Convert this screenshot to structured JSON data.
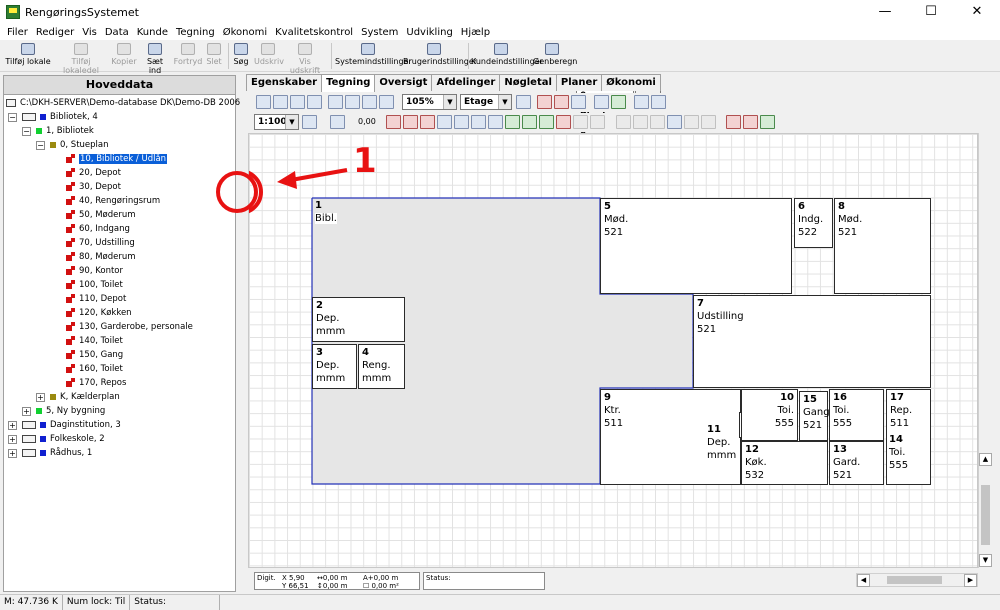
{
  "window": {
    "title": "RengøringsSystemet",
    "min": "—",
    "max": "☐",
    "close": "✕"
  },
  "menu": [
    "Filer",
    "Rediger",
    "Vis",
    "Data",
    "Kunde",
    "Tegning",
    "Økonomi",
    "Kvalitetskontrol",
    "System",
    "Udvikling",
    "Hjælp"
  ],
  "toolbar": {
    "add_room": "Tilføj lokale",
    "add_room_part": "Tilføj lokaledel",
    "copy": "Kopier",
    "paste": "Sæt ind",
    "undo": "Fortryd",
    "delete": "Slet",
    "search": "Søg",
    "print": "Udskriv",
    "print_preview": "Vis udskrift",
    "system_settings": "Systemindstillinger",
    "user_settings": "Brugerindstillinger",
    "customer_settings": "Kundeindstillinger",
    "recalc": "Genberegn",
    "plan_type": "0: Plantype 0",
    "plan_button": "..."
  },
  "left_panel": {
    "header": "Hoveddata",
    "root": "C:\\DKH-SERVER\\Demo-database DK\\Demo-DB 2006",
    "items": [
      {
        "label": "Bibliotek, 4"
      },
      {
        "label": "1, Bibliotek"
      },
      {
        "label": "0, Stueplan"
      },
      {
        "label": "10, Bibliotek / Udlån"
      },
      {
        "label": "20, Depot"
      },
      {
        "label": "30, Depot"
      },
      {
        "label": "40, Rengøringsrum"
      },
      {
        "label": "50, Møderum"
      },
      {
        "label": "60, Indgang"
      },
      {
        "label": "70, Udstilling"
      },
      {
        "label": "80, Møderum"
      },
      {
        "label": "90, Kontor"
      },
      {
        "label": "100, Toilet"
      },
      {
        "label": "110, Depot"
      },
      {
        "label": "120, Køkken"
      },
      {
        "label": "130, Garderobe, personale"
      },
      {
        "label": "140, Toilet"
      },
      {
        "label": "150, Gang"
      },
      {
        "label": "160, Toilet"
      },
      {
        "label": "170, Repos"
      },
      {
        "label": "K, Kælderplan"
      },
      {
        "label": "5, Ny bygning"
      },
      {
        "label": "Daginstitution, 3"
      },
      {
        "label": "Folkeskole, 2"
      },
      {
        "label": "Rådhus, 1"
      }
    ]
  },
  "tabs": [
    "Egenskaber",
    "Tegning",
    "Oversigt",
    "Afdelinger",
    "Nøgletal",
    "Planer",
    "Økonomi"
  ],
  "drawing_toolbar": {
    "zoom": "105%",
    "level": "Etage",
    "scale": "1:100",
    "value": "0,00"
  },
  "annotation": {
    "label": "1",
    "color": "#e81212"
  },
  "rooms": [
    {
      "num": "1",
      "name": "Bibl.",
      "code": ""
    },
    {
      "num": "2",
      "name": "Dep.",
      "code": "mmm"
    },
    {
      "num": "3",
      "name": "Dep.",
      "code": "mmm"
    },
    {
      "num": "4",
      "name": "Reng.",
      "code": "mmm"
    },
    {
      "num": "5",
      "name": "Mød.",
      "code": "521"
    },
    {
      "num": "6",
      "name": "Indg.",
      "code": "522"
    },
    {
      "num": "7",
      "name": "Udstilling",
      "code": "521"
    },
    {
      "num": "8",
      "name": "Mød.",
      "code": "521"
    },
    {
      "num": "9",
      "name": "Ktr.",
      "code": "511"
    },
    {
      "num": "10",
      "name": "Toi.",
      "code": "555"
    },
    {
      "num": "11",
      "name": "Dep.",
      "code": "mmm"
    },
    {
      "num": "12",
      "name": "Køk.",
      "code": "532"
    },
    {
      "num": "13",
      "name": "Gard.",
      "code": "521"
    },
    {
      "num": "14",
      "name": "Toi.",
      "code": "555"
    },
    {
      "num": "15",
      "name": "Gang",
      "code": "521"
    },
    {
      "num": "16",
      "name": "Toi.",
      "code": "555"
    },
    {
      "num": "17",
      "name": "Rep.",
      "code": "511"
    }
  ],
  "info": {
    "digit": "Digit.",
    "x_label": "X",
    "x": "5,90",
    "y_label": "Y",
    "y": "66,51",
    "l1": "↔0,00 m",
    "l2": "↕0,00 m",
    "a1": "A+0,00 m",
    "a2": "☐ 0,00 m²",
    "status": "Status:"
  },
  "statusbar": {
    "memory": "M: 47.736 K",
    "numlock": "Num lock: Til",
    "status": "Status:"
  }
}
